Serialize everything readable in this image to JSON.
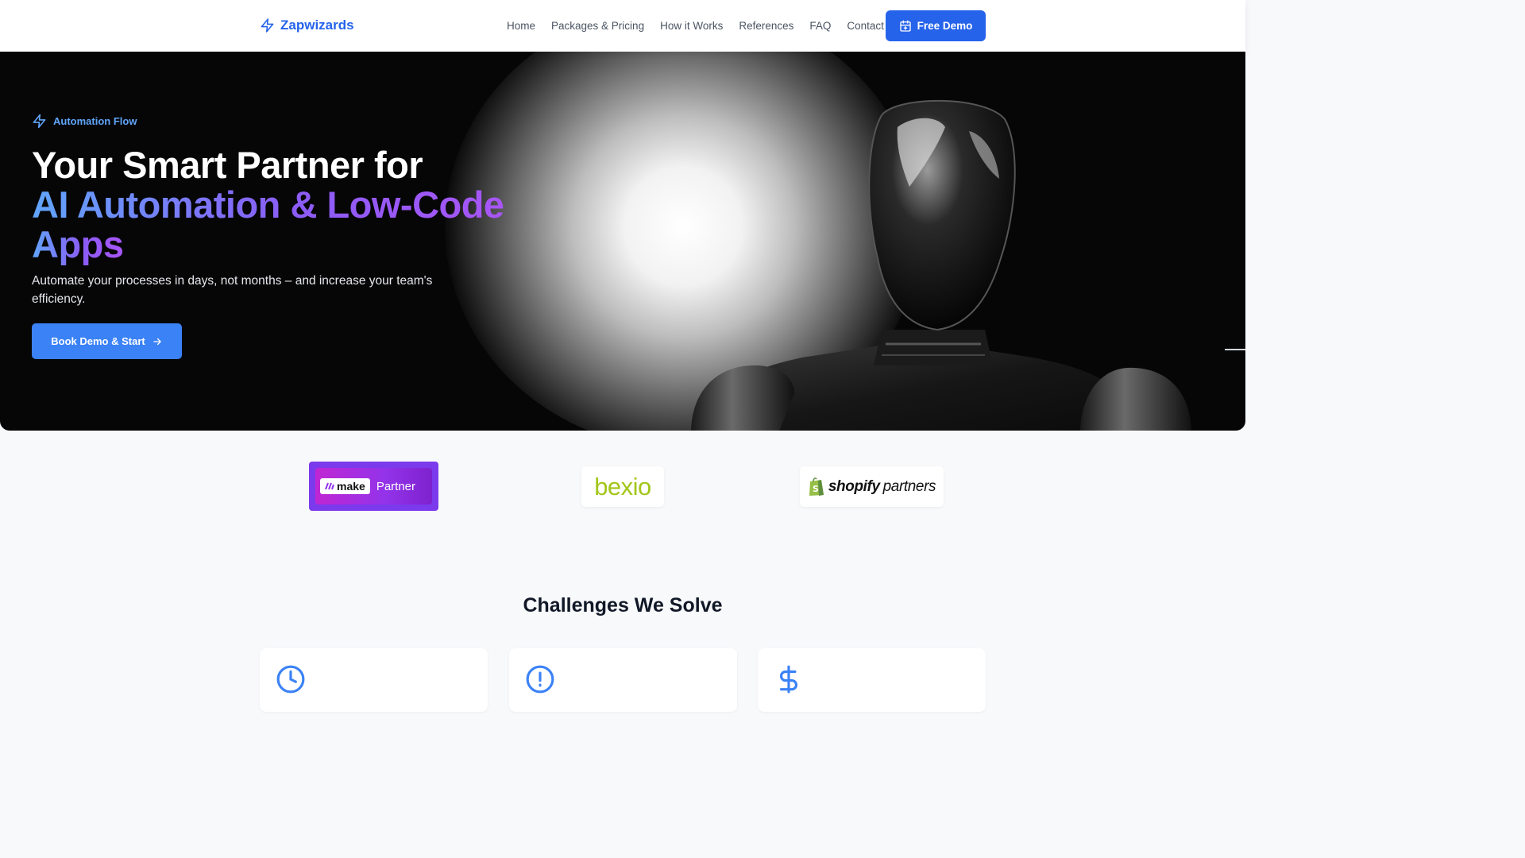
{
  "nav": {
    "brand": "Zapwizards",
    "brand_icon": "lightning-icon",
    "links": [
      "Home",
      "Packages & Pricing",
      "How it Works",
      "References",
      "FAQ",
      "Contact"
    ],
    "cta_label": "Free Demo",
    "cta_icon": "calendar-plus-icon"
  },
  "hero": {
    "eyebrow": "Automation Flow",
    "headline_line1": "Your Smart Partner for",
    "headline_line2": "AI Automation & Low-Code",
    "headline_line3": "Apps",
    "subtitle": "Automate your processes in days, not months – and increase your team's efficiency.",
    "cta_label": "Book Demo & Start",
    "cta_icon": "arrow-right-icon"
  },
  "partners": {
    "make_word": "make",
    "make_tag": "Partner",
    "bexio": "bexio",
    "shopify_word": "shopify",
    "shopify_tag": "partners"
  },
  "challenges": {
    "title": "Challenges We Solve",
    "cards": [
      {
        "icon": "clock-icon"
      },
      {
        "icon": "alert-circle-icon"
      },
      {
        "icon": "dollar-icon"
      }
    ]
  },
  "colors": {
    "primary": "#2563eb",
    "cta_blue": "#3b82f6",
    "gradient_start": "#60a5fa",
    "gradient_end": "#a855f7",
    "bexio_green": "#a3c61a",
    "make_purple": "#7c3aed"
  }
}
